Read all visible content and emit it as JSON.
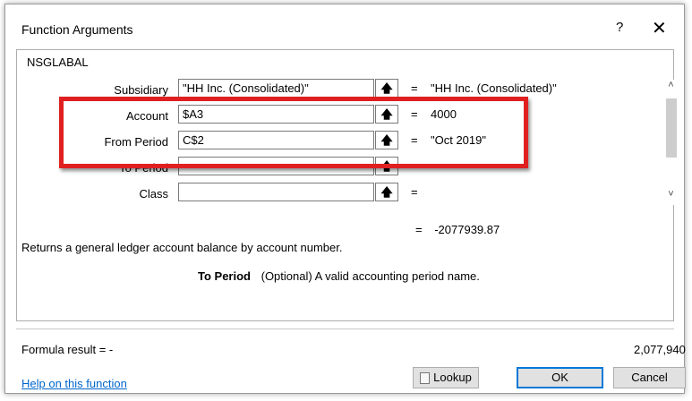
{
  "window": {
    "title": "Function Arguments",
    "help_glyph": "?",
    "close_glyph": "✕"
  },
  "function": {
    "name": "NSGLABAL",
    "arguments": [
      {
        "label": "Subsidiary",
        "value": "\"HH Inc. (Consolidated)\"",
        "result": "\"HH Inc. (Consolidated)\""
      },
      {
        "label": "Account",
        "value": "$A3",
        "result": "4000"
      },
      {
        "label": "From Period",
        "value": "C$2",
        "result": "\"Oct 2019\""
      },
      {
        "label": "To Period",
        "value": "",
        "result": ""
      },
      {
        "label": "Class",
        "value": "",
        "result": ""
      }
    ],
    "equals": "=",
    "result_value": "-2077939.87",
    "description": "Returns a general ledger account balance by account number.",
    "arg_help_name": "To Period",
    "arg_help_text": "(Optional) A valid accounting period name."
  },
  "footer": {
    "formula_result_label": "Formula result =  -",
    "formula_result_value": "2,077,940",
    "help_link": "Help on this function"
  },
  "buttons": {
    "lookup": "Lookup",
    "ok": "OK",
    "cancel": "Cancel"
  },
  "icons": {
    "collapse": "upload-arrow-icon",
    "scroll_up": "chevron-up-icon",
    "scroll_down": "chevron-down-icon",
    "lookup": "document-icon"
  },
  "colors": {
    "highlight": "#e02020",
    "link": "#0066cc",
    "ok_border": "#0078d7"
  }
}
